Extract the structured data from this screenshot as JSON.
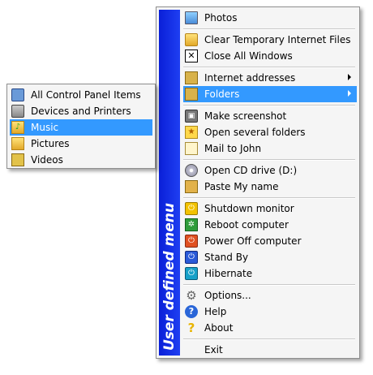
{
  "main_menu": {
    "banner": "User defined menu",
    "items": [
      {
        "label": "Photos",
        "icon": "monitor-icon"
      },
      {
        "label": "Clear Temporary Internet Files",
        "icon": "folder-icon"
      },
      {
        "label": "Close All Windows",
        "icon": "close-icon"
      },
      {
        "label": "Internet addresses",
        "icon": "folder-grid-icon",
        "submenu": true
      },
      {
        "label": "Folders",
        "icon": "folder-grid-icon",
        "submenu": true,
        "highlighted": true
      },
      {
        "label": "Make screenshot",
        "icon": "camera-icon"
      },
      {
        "label": "Open several folders",
        "icon": "star-folder-icon"
      },
      {
        "label": "Mail to John",
        "icon": "mail-icon"
      },
      {
        "label": "Open CD drive (D:)",
        "icon": "cd-icon"
      },
      {
        "label": "Paste My name",
        "icon": "paste-icon"
      },
      {
        "label": "Shutdown monitor",
        "icon": "power-yellow-icon"
      },
      {
        "label": "Reboot computer",
        "icon": "reboot-icon"
      },
      {
        "label": "Power Off computer",
        "icon": "power-red-icon"
      },
      {
        "label": "Stand By",
        "icon": "standby-icon"
      },
      {
        "label": "Hibernate",
        "icon": "hibernate-icon"
      },
      {
        "label": "Options...",
        "icon": "gear-icon"
      },
      {
        "label": "Help",
        "icon": "help-icon"
      },
      {
        "label": "About",
        "icon": "about-icon"
      },
      {
        "label": "Exit",
        "icon": ""
      }
    ]
  },
  "folders_submenu": {
    "items": [
      {
        "label": "All Control Panel Items",
        "icon": "control-panel-icon"
      },
      {
        "label": "Devices and Printers",
        "icon": "printer-icon"
      },
      {
        "label": "Music",
        "icon": "music-folder-icon",
        "highlighted": true
      },
      {
        "label": "Pictures",
        "icon": "pictures-folder-icon"
      },
      {
        "label": "Videos",
        "icon": "videos-folder-icon"
      }
    ]
  },
  "colors": {
    "highlight": "#3399ff",
    "banner": "#1530e8",
    "menu_background": "#f5f5f5"
  }
}
